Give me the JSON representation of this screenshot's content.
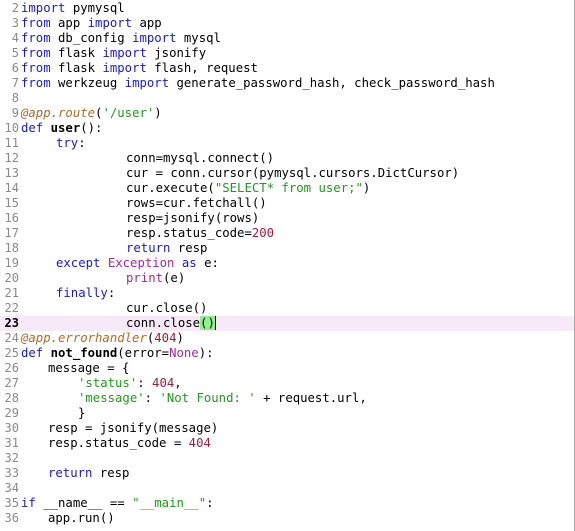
{
  "editor": {
    "current_line": 23,
    "lines": [
      {
        "n": "2",
        "indent": 0,
        "tokens": [
          {
            "t": "import",
            "c": "kw"
          },
          {
            "t": " pymysql"
          }
        ]
      },
      {
        "n": "3",
        "indent": 0,
        "tokens": [
          {
            "t": "from",
            "c": "kw"
          },
          {
            "t": " app "
          },
          {
            "t": "import",
            "c": "kw"
          },
          {
            "t": " app"
          }
        ]
      },
      {
        "n": "4",
        "indent": 0,
        "tokens": [
          {
            "t": "from",
            "c": "kw"
          },
          {
            "t": " db_config "
          },
          {
            "t": "import",
            "c": "kw"
          },
          {
            "t": " mysql"
          }
        ]
      },
      {
        "n": "5",
        "indent": 0,
        "tokens": [
          {
            "t": "from",
            "c": "kw"
          },
          {
            "t": " flask "
          },
          {
            "t": "import",
            "c": "kw"
          },
          {
            "t": " jsonify"
          }
        ]
      },
      {
        "n": "6",
        "indent": 0,
        "tokens": [
          {
            "t": "from",
            "c": "kw"
          },
          {
            "t": " flask "
          },
          {
            "t": "import",
            "c": "kw"
          },
          {
            "t": " flash, request"
          }
        ]
      },
      {
        "n": "7",
        "indent": 0,
        "tokens": [
          {
            "t": "from",
            "c": "kw"
          },
          {
            "t": " werkzeug "
          },
          {
            "t": "import",
            "c": "kw"
          },
          {
            "t": " generate_password_hash, check_password_hash"
          }
        ]
      },
      {
        "n": "8",
        "indent": 0,
        "tokens": []
      },
      {
        "n": "9",
        "indent": 0,
        "tokens": [
          {
            "t": "@app.route",
            "c": "dec"
          },
          {
            "t": "("
          },
          {
            "t": "'/user'",
            "c": "str"
          },
          {
            "t": ")"
          }
        ]
      },
      {
        "n": "10",
        "indent": 0,
        "tokens": [
          {
            "t": "def",
            "c": "kw"
          },
          {
            "t": " "
          },
          {
            "t": "user",
            "c": "fn"
          },
          {
            "t": "():"
          }
        ]
      },
      {
        "n": "11",
        "indent": 35,
        "tokens": [
          {
            "t": "try",
            "c": "kw"
          },
          {
            "t": ":"
          }
        ]
      },
      {
        "n": "12",
        "indent": 105,
        "tokens": [
          {
            "t": "conn=mysql.connect()"
          }
        ]
      },
      {
        "n": "13",
        "indent": 105,
        "tokens": [
          {
            "t": "cur = conn.cursor(pymysql.cursors.DictCursor)"
          }
        ]
      },
      {
        "n": "14",
        "indent": 105,
        "tokens": [
          {
            "t": "cur.execute("
          },
          {
            "t": "\"SELECT* from user;\"",
            "c": "str"
          },
          {
            "t": ")"
          }
        ]
      },
      {
        "n": "15",
        "indent": 105,
        "tokens": [
          {
            "t": "rows=cur.fetchall()"
          }
        ]
      },
      {
        "n": "16",
        "indent": 105,
        "tokens": [
          {
            "t": "resp=jsonify(rows)"
          }
        ]
      },
      {
        "n": "17",
        "indent": 105,
        "tokens": [
          {
            "t": "resp.status_code="
          },
          {
            "t": "200",
            "c": "num"
          }
        ]
      },
      {
        "n": "18",
        "indent": 105,
        "tokens": [
          {
            "t": "return",
            "c": "kw"
          },
          {
            "t": " resp"
          }
        ]
      },
      {
        "n": "19",
        "indent": 35,
        "tokens": [
          {
            "t": "except",
            "c": "kw"
          },
          {
            "t": " "
          },
          {
            "t": "Exception",
            "c": "bi"
          },
          {
            "t": " "
          },
          {
            "t": "as",
            "c": "kw"
          },
          {
            "t": " e:"
          }
        ]
      },
      {
        "n": "20",
        "indent": 105,
        "tokens": [
          {
            "t": "print",
            "c": "bi"
          },
          {
            "t": "(e)"
          }
        ]
      },
      {
        "n": "21",
        "indent": 35,
        "tokens": [
          {
            "t": "finally",
            "c": "kw"
          },
          {
            "t": ":"
          }
        ]
      },
      {
        "n": "22",
        "indent": 105,
        "tokens": [
          {
            "t": "cur.close()"
          }
        ]
      },
      {
        "n": "23",
        "indent": 105,
        "tokens": [
          {
            "t": "conn.close"
          },
          {
            "t": "()",
            "c": "match"
          },
          {
            "t": "",
            "c": "caret"
          }
        ]
      },
      {
        "n": "24",
        "indent": 0,
        "tokens": [
          {
            "t": "@app.errorhandler",
            "c": "dec"
          },
          {
            "t": "("
          },
          {
            "t": "404",
            "c": "num"
          },
          {
            "t": ")"
          }
        ]
      },
      {
        "n": "25",
        "indent": 0,
        "tokens": [
          {
            "t": "def",
            "c": "kw"
          },
          {
            "t": " "
          },
          {
            "t": "not_found",
            "c": "fn"
          },
          {
            "t": "(error="
          },
          {
            "t": "None",
            "c": "bi"
          },
          {
            "t": "):"
          }
        ]
      },
      {
        "n": "26",
        "indent": 27,
        "tokens": [
          {
            "t": "message = {"
          }
        ]
      },
      {
        "n": "27",
        "indent": 57,
        "tokens": [
          {
            "t": "'status'",
            "c": "str"
          },
          {
            "t": ": "
          },
          {
            "t": "404",
            "c": "num"
          },
          {
            "t": ","
          }
        ]
      },
      {
        "n": "28",
        "indent": 57,
        "tokens": [
          {
            "t": "'message'",
            "c": "str"
          },
          {
            "t": ": "
          },
          {
            "t": "'Not Found: '",
            "c": "str"
          },
          {
            "t": " + request.url,"
          }
        ]
      },
      {
        "n": "29",
        "indent": 57,
        "tokens": [
          {
            "t": "}"
          }
        ]
      },
      {
        "n": "30",
        "indent": 27,
        "tokens": [
          {
            "t": "resp = jsonify(message)"
          }
        ]
      },
      {
        "n": "31",
        "indent": 27,
        "tokens": [
          {
            "t": "resp.status_code = "
          },
          {
            "t": "404",
            "c": "num"
          }
        ]
      },
      {
        "n": "32",
        "indent": 0,
        "tokens": []
      },
      {
        "n": "33",
        "indent": 27,
        "tokens": [
          {
            "t": "return",
            "c": "kw"
          },
          {
            "t": " resp"
          }
        ]
      },
      {
        "n": "34",
        "indent": 0,
        "tokens": []
      },
      {
        "n": "35",
        "indent": 0,
        "tokens": [
          {
            "t": "if",
            "c": "kw"
          },
          {
            "t": " __name__ == "
          },
          {
            "t": "\"__main__\"",
            "c": "str"
          },
          {
            "t": ":"
          }
        ]
      },
      {
        "n": "36",
        "indent": 27,
        "tokens": [
          {
            "t": "app.run()"
          }
        ]
      }
    ]
  }
}
